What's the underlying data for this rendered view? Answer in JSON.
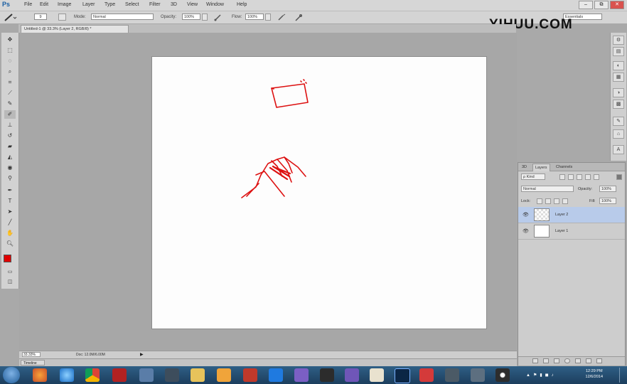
{
  "app": {
    "logo": "Ps"
  },
  "menu": [
    "File",
    "Edit",
    "Image",
    "Layer",
    "Type",
    "Select",
    "Filter",
    "3D",
    "View",
    "Window",
    "Help"
  ],
  "window_controls": [
    "–",
    "⧉",
    "✕"
  ],
  "options_bar": {
    "brush_size": "9",
    "mode_label": "Mode:",
    "mode_value": "Normal",
    "opacity_label": "Opacity:",
    "opacity_value": "100%",
    "flow_label": "Flow:",
    "flow_value": "100%",
    "workspace": "Essentials"
  },
  "watermark": "YIHUU.COM",
  "document_tab": "Untitled-1 @ 33.3% (Layer 2, RGB/8) *",
  "status": {
    "zoom": "33.33%",
    "doc_size": "Doc: 12.0M/6.00M"
  },
  "timeline_label": "Timeline",
  "colors": {
    "foreground": "#e00000",
    "background": "#000000",
    "stroke": "#dd1111",
    "selected_layer": "#b8cbea"
  },
  "toolbox": [
    "move-icon",
    "marquee-icon",
    "lasso-icon",
    "quick-select-icon",
    "crop-icon",
    "eyedropper-icon",
    "healing-icon",
    "brush-icon",
    "stamp-icon",
    "history-brush-icon",
    "eraser-icon",
    "gradient-icon",
    "blur-icon",
    "dodge-icon",
    "pen-icon",
    "type-icon",
    "path-select-icon",
    "shape-icon",
    "hand-icon",
    "zoom-icon"
  ],
  "layers_panel": {
    "tabs": [
      "3D",
      "Layers",
      "Channels"
    ],
    "active_tab": "Layers",
    "filter_kind": "ρ Kind",
    "blend_mode": "Normal",
    "opacity_label": "Opacity:",
    "opacity_value": "100%",
    "lock_label": "Lock:",
    "fill_label": "Fill:",
    "fill_value": "100%",
    "layers": [
      {
        "name": "Layer 2",
        "selected": true
      },
      {
        "name": "Layer 1",
        "selected": false
      }
    ]
  },
  "taskbar": {
    "time": "12:29 PM",
    "date": "12/6/2014"
  }
}
